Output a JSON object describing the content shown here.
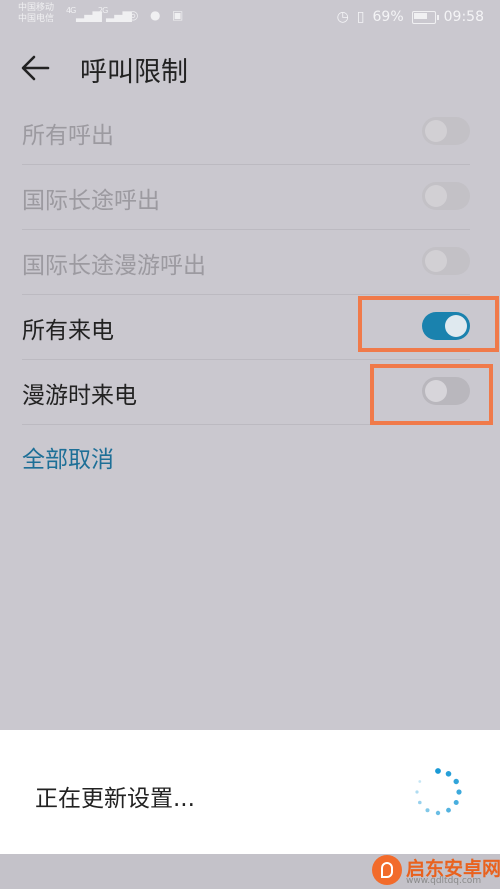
{
  "status_bar": {
    "carrier1": "中国移动",
    "carrier2": "中国电信",
    "network1": "4G",
    "network2": "2G",
    "battery_percent": "69%",
    "time": "09:58"
  },
  "app_bar": {
    "title": "呼叫限制"
  },
  "settings": [
    {
      "label": "所有呼出",
      "enabled": false,
      "on": false
    },
    {
      "label": "国际长途呼出",
      "enabled": false,
      "on": false
    },
    {
      "label": "国际长途漫游呼出",
      "enabled": false,
      "on": false
    },
    {
      "label": "所有来电",
      "enabled": true,
      "on": true
    },
    {
      "label": "漫游时来电",
      "enabled": true,
      "on": false
    }
  ],
  "cancel_all_label": "全部取消",
  "dialog": {
    "message": "正在更新设置..."
  },
  "watermark": {
    "name": "启东安卓网",
    "url": "www.qdltdq.com"
  },
  "colors": {
    "accent": "#1a82ae",
    "highlight": "#f07a4a"
  }
}
